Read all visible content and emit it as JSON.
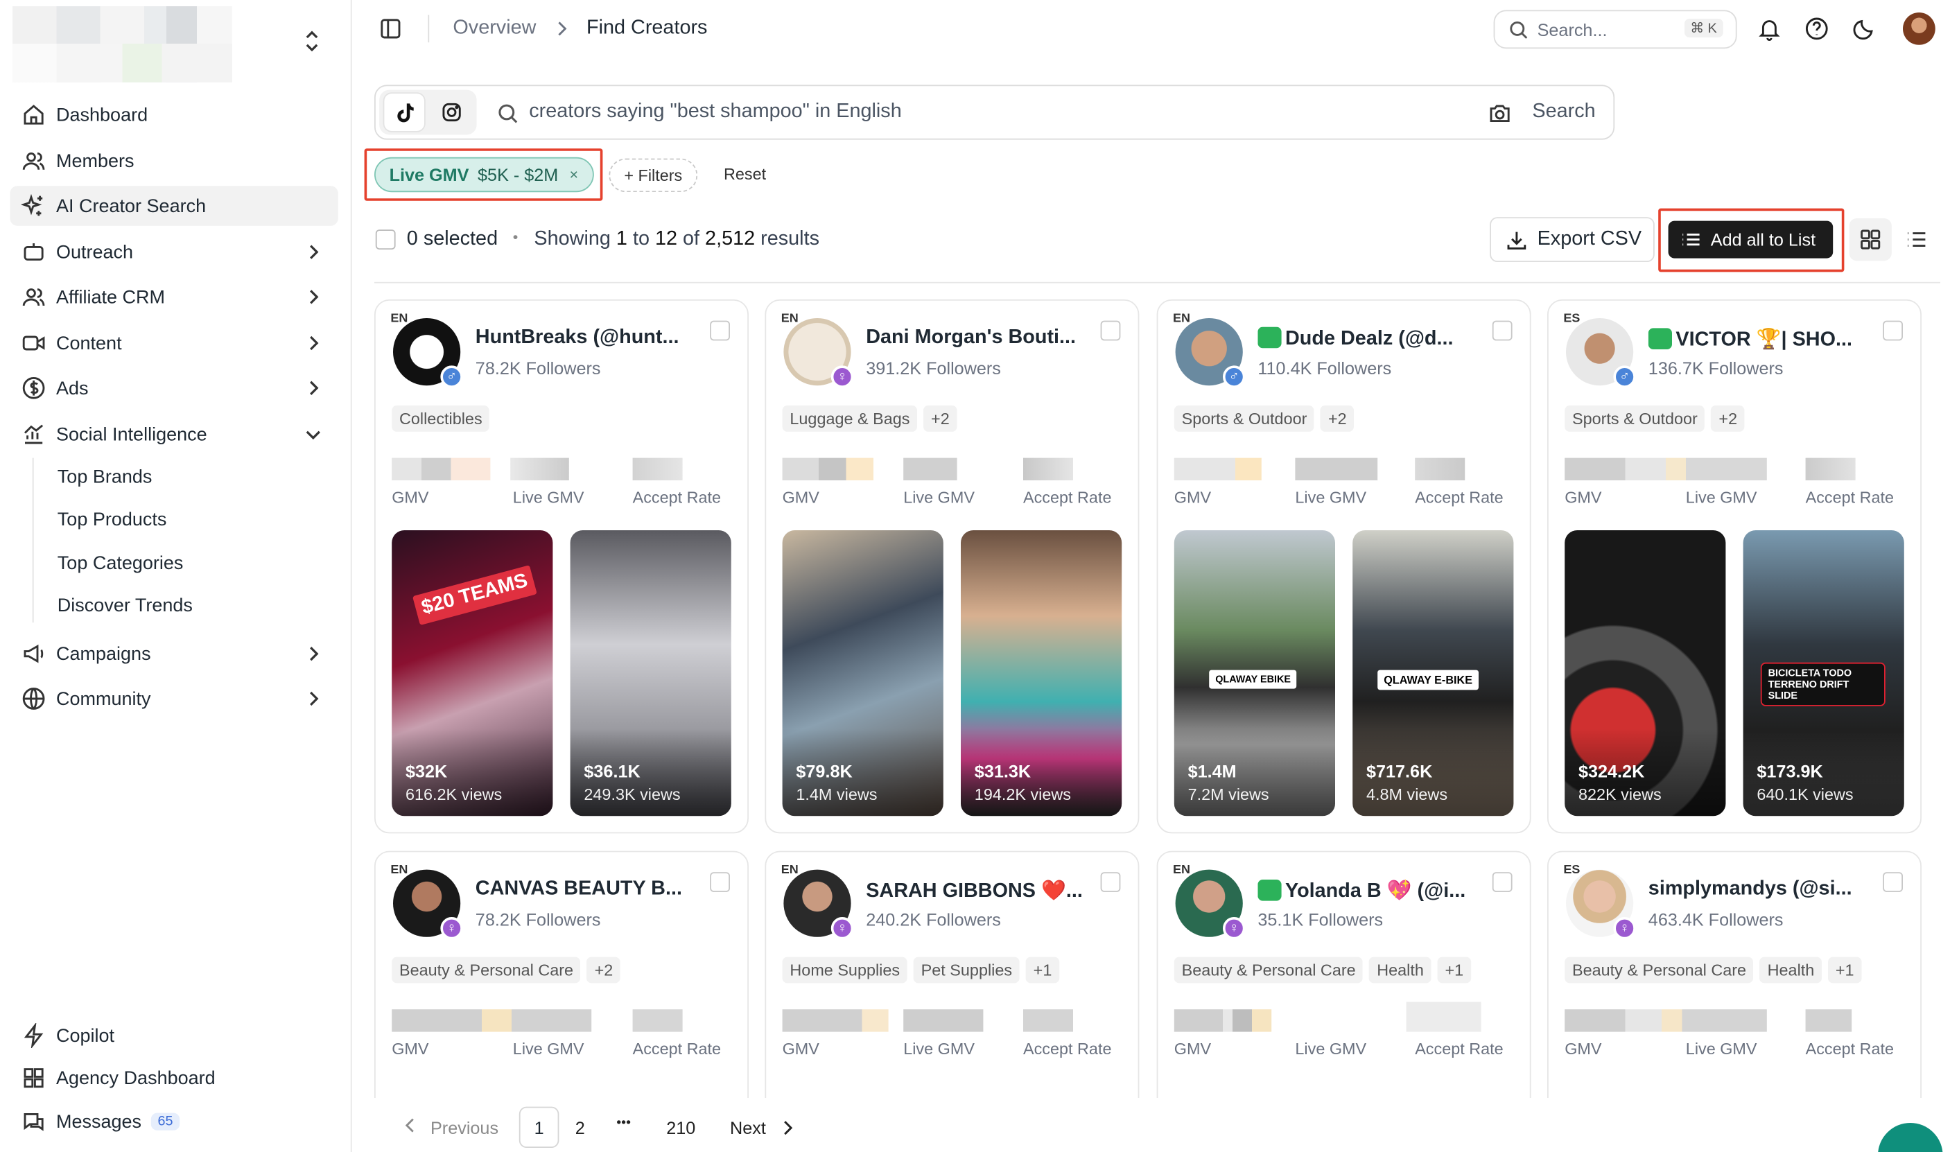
{
  "sidebar": {
    "nav": [
      {
        "label": "Dashboard",
        "icon": "home-icon"
      },
      {
        "label": "Members",
        "icon": "users-icon"
      },
      {
        "label": "AI Creator Search",
        "icon": "sparkle-icon"
      },
      {
        "label": "Outreach",
        "icon": "robot-icon"
      },
      {
        "label": "Affiliate CRM",
        "icon": "users-icon"
      },
      {
        "label": "Content",
        "icon": "video-icon"
      },
      {
        "label": "Ads",
        "icon": "dollar-icon"
      },
      {
        "label": "Social Intelligence",
        "icon": "chart-icon"
      },
      {
        "label": "Campaigns",
        "icon": "megaphone-icon"
      },
      {
        "label": "Community",
        "icon": "globe-icon"
      }
    ],
    "social_sub": [
      "Top Brands",
      "Top Products",
      "Top Categories",
      "Discover Trends"
    ],
    "bottom": [
      {
        "label": "Copilot",
        "icon": "bolt-icon"
      },
      {
        "label": "Agency Dashboard",
        "icon": "grid-icon"
      },
      {
        "label": "Messages",
        "icon": "messages-icon",
        "badge": "65"
      }
    ]
  },
  "header": {
    "breadcrumb": [
      "Overview",
      "Find Creators"
    ],
    "search_placeholder": "Search...",
    "shortcut": "⌘ K"
  },
  "query": {
    "text": "creators saying \"best shampoo\" in English",
    "search_label": "Search"
  },
  "filters": {
    "chip_key": "Live GMV",
    "chip_value": "$5K - $2M",
    "chip_remove": "×",
    "add_filters": "+ Filters",
    "reset": "Reset"
  },
  "results": {
    "selected": "0 selected",
    "dot": "•",
    "showing_prefix": "Showing",
    "from": "1",
    "to_word": "to",
    "to": "12",
    "of_word": "of",
    "total": "2,512",
    "suffix": "results",
    "export": "Export CSV",
    "add_all": "Add all to List"
  },
  "metric_labels": [
    "GMV",
    "Live GMV",
    "Accept Rate"
  ],
  "creators": [
    {
      "lang": "EN",
      "name": "HuntBreaks (@hunt...",
      "followers": "78.2K Followers",
      "gender": "male",
      "tags": [
        "Collectibles"
      ],
      "trend": false,
      "videos": [
        {
          "value": "$32K",
          "views": "616.2K views",
          "overlay": "$20 TEAMS"
        },
        {
          "value": "$36.1K",
          "views": "249.3K views",
          "overlay": ""
        }
      ]
    },
    {
      "lang": "EN",
      "name": "Dani Morgan's Bouti...",
      "followers": "391.2K Followers",
      "gender": "female",
      "tags": [
        "Luggage & Bags",
        "+2"
      ],
      "trend": false,
      "videos": [
        {
          "value": "$79.8K",
          "views": "1.4M views",
          "overlay": ""
        },
        {
          "value": "$31.3K",
          "views": "194.2K views",
          "overlay": ""
        }
      ]
    },
    {
      "lang": "EN",
      "name": "Dude Dealz (@d...",
      "followers": "110.4K Followers",
      "gender": "male",
      "tags": [
        "Sports & Outdoor",
        "+2"
      ],
      "trend": true,
      "videos": [
        {
          "value": "$1.4M",
          "views": "7.2M views",
          "overlay": "QLAWAY EBIKE"
        },
        {
          "value": "$717.6K",
          "views": "4.8M views",
          "overlay": "QLAWAY E-BIKE"
        }
      ]
    },
    {
      "lang": "ES",
      "name": "VICTOR 🏆| SHO...",
      "followers": "136.7K Followers",
      "gender": "male",
      "tags": [
        "Sports & Outdoor",
        "+2"
      ],
      "trend": true,
      "videos": [
        {
          "value": "$324.2K",
          "views": "822K views",
          "overlay": ""
        },
        {
          "value": "$173.9K",
          "views": "640.1K views",
          "overlay": "BICICLETA TODO TERRENO DRIFT SLIDE"
        }
      ]
    },
    {
      "lang": "EN",
      "name": "CANVAS BEAUTY B...",
      "followers": "78.2K Followers",
      "gender": "female",
      "tags": [
        "Beauty & Personal Care",
        "+2"
      ],
      "trend": false,
      "videos": []
    },
    {
      "lang": "EN",
      "name": "SARAH GIBBONS ❤️...",
      "followers": "240.2K Followers",
      "gender": "female",
      "tags": [
        "Home Supplies",
        "Pet Supplies",
        "+1"
      ],
      "trend": false,
      "videos": []
    },
    {
      "lang": "EN",
      "name": "Yolanda B 💖 (@i...",
      "followers": "35.1K Followers",
      "gender": "female",
      "tags": [
        "Beauty & Personal Care",
        "Health",
        "+1"
      ],
      "trend": true,
      "videos": []
    },
    {
      "lang": "ES",
      "name": "simplymandys (@si...",
      "followers": "463.4K Followers",
      "gender": "female",
      "tags": [
        "Beauty & Personal Care",
        "Health",
        "+1"
      ],
      "trend": false,
      "videos": []
    }
  ],
  "pagination": {
    "previous": "Previous",
    "pages": [
      "1",
      "2",
      "210"
    ],
    "ellipsis": "•••",
    "next": "Next",
    "current": "1"
  },
  "colors": {
    "accent": "#1c1c1c",
    "chip": "#d7efea",
    "highlight": "#e5412d",
    "trend": "#2cb25a"
  }
}
